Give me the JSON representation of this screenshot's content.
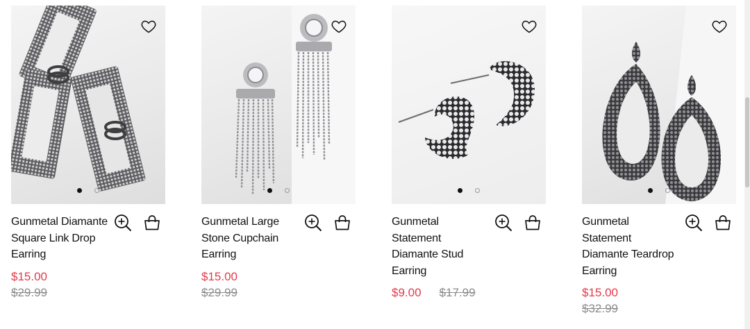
{
  "products": [
    {
      "name": "Gunmetal Diamante Square Link Drop Earring",
      "sale_price": "$15.00",
      "original_price": "$29.99",
      "image_icon": "square-link-earring-image",
      "active_dot": 1,
      "dot_count": 2
    },
    {
      "name": "Gunmetal Large Stone Cupchain Earring",
      "sale_price": "$15.00",
      "original_price": "$29.99",
      "image_icon": "cupchain-earring-image",
      "active_dot": 1,
      "dot_count": 2
    },
    {
      "name": "Gunmetal Statement Diamante Stud Earring",
      "sale_price": "$9.00",
      "original_price": "$17.99",
      "image_icon": "hoop-stud-earring-image",
      "active_dot": 1,
      "dot_count": 2
    },
    {
      "name": "Gunmetal Statement Diamante Teardrop Earring",
      "sale_price": "$15.00",
      "original_price": "$32.99",
      "image_icon": "teardrop-earring-image",
      "active_dot": 1,
      "dot_count": 2
    }
  ],
  "icons": {
    "wishlist": "heart-icon",
    "quick_view": "zoom-in-icon",
    "add_to_bag": "shopping-bag-icon"
  },
  "colors": {
    "sale": "#e23a4a",
    "original": "#8a8a8a",
    "text": "#111111"
  }
}
